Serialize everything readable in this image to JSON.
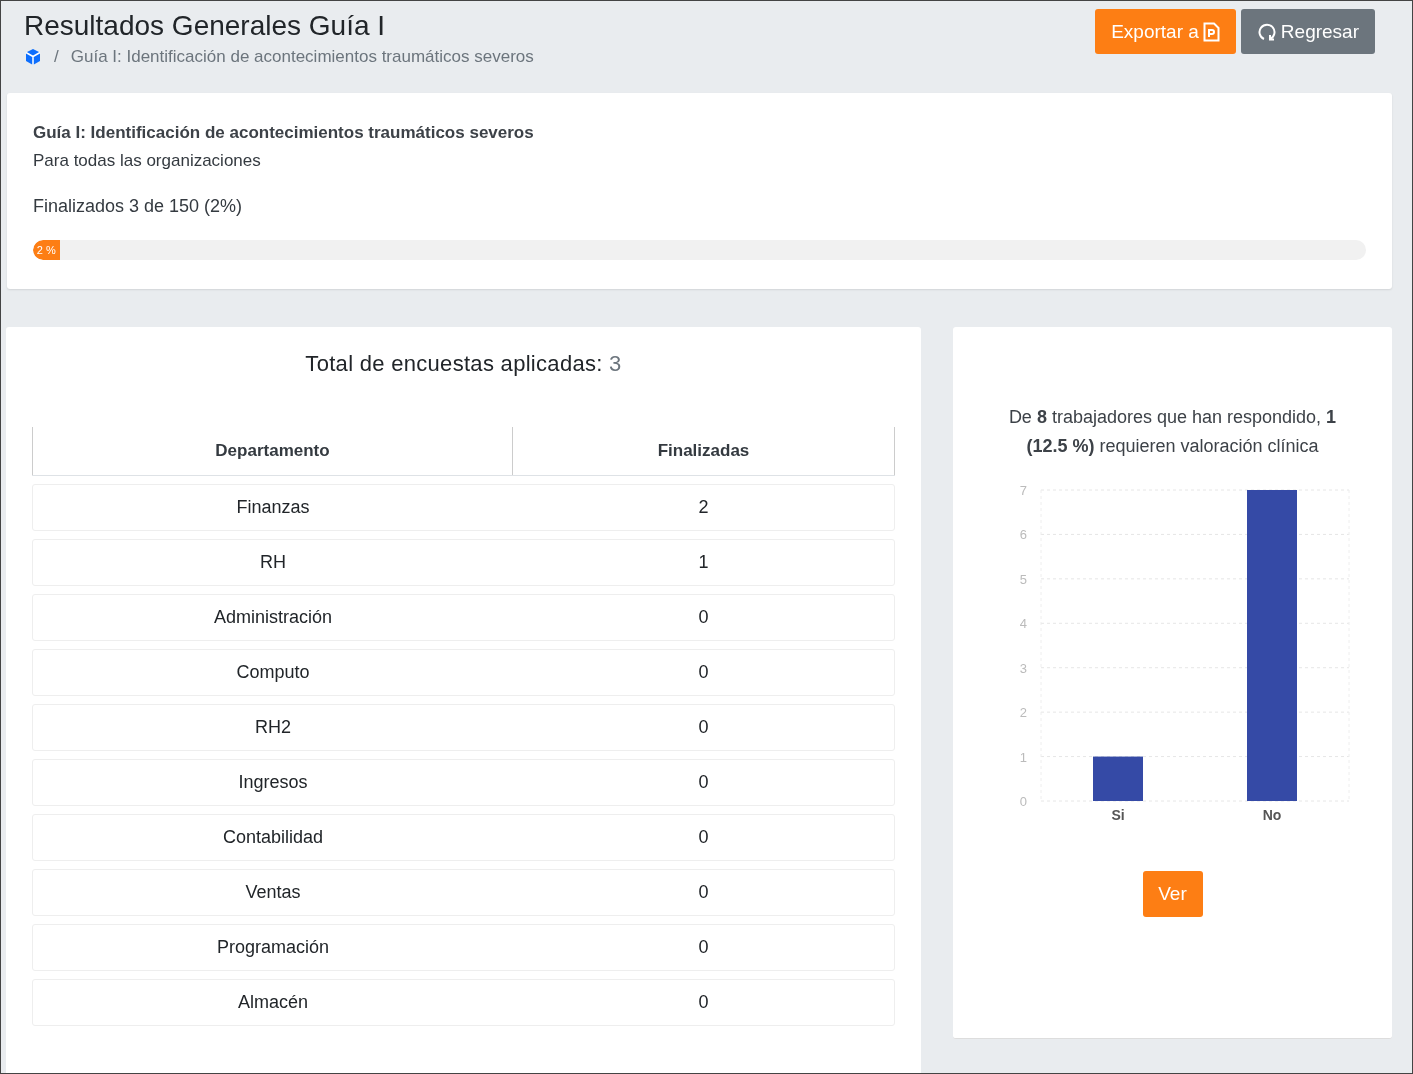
{
  "header": {
    "title": "Resultados Generales Guía I",
    "breadcrumb_separator": "/",
    "breadcrumb": [
      "Guía I: Identificación de acontecimientos traumáticos severos"
    ],
    "buttons": [
      {
        "label": "Exportar a",
        "kind": "export"
      },
      {
        "label": "Regresar",
        "kind": "back"
      }
    ]
  },
  "summary": {
    "title": "Guía I: Identificación de acontecimientos traumáticos severos",
    "subtitle": "Para todas las organizaciones",
    "progress_text": "Finalizados 3 de 150 (2%)",
    "progress": {
      "level": 0.02,
      "label": "2 %"
    }
  },
  "survey_table": {
    "heading": "Total de encuestas aplicadas:",
    "total": "3",
    "columns": [
      "Departamento",
      "Finalizadas"
    ],
    "rows": [
      [
        "Finanzas",
        "2"
      ],
      [
        "RH",
        "1"
      ],
      [
        "Administración",
        "0"
      ],
      [
        "Computo",
        "0"
      ],
      [
        "RH2",
        "0"
      ],
      [
        "Ingresos",
        "0"
      ],
      [
        "Contabilidad",
        "0"
      ],
      [
        "Ventas",
        "0"
      ],
      [
        "Programación",
        "0"
      ],
      [
        "Almacén",
        "0"
      ]
    ]
  },
  "clinical": {
    "summary": "De **8** trabajadores que han respondido, **1 (12.5 %)** requieren valoración clínica",
    "chart_data": {
      "type": "bar",
      "categories": [
        "Si",
        "No"
      ],
      "series": [
        {
          "color": "#354aa6",
          "values": [
            1,
            7
          ]
        }
      ],
      "grid": true,
      "ylim": [
        0,
        7
      ],
      "yticks": [
        0,
        1,
        2,
        3,
        4,
        5,
        6,
        7
      ]
    },
    "button": "Ver"
  }
}
